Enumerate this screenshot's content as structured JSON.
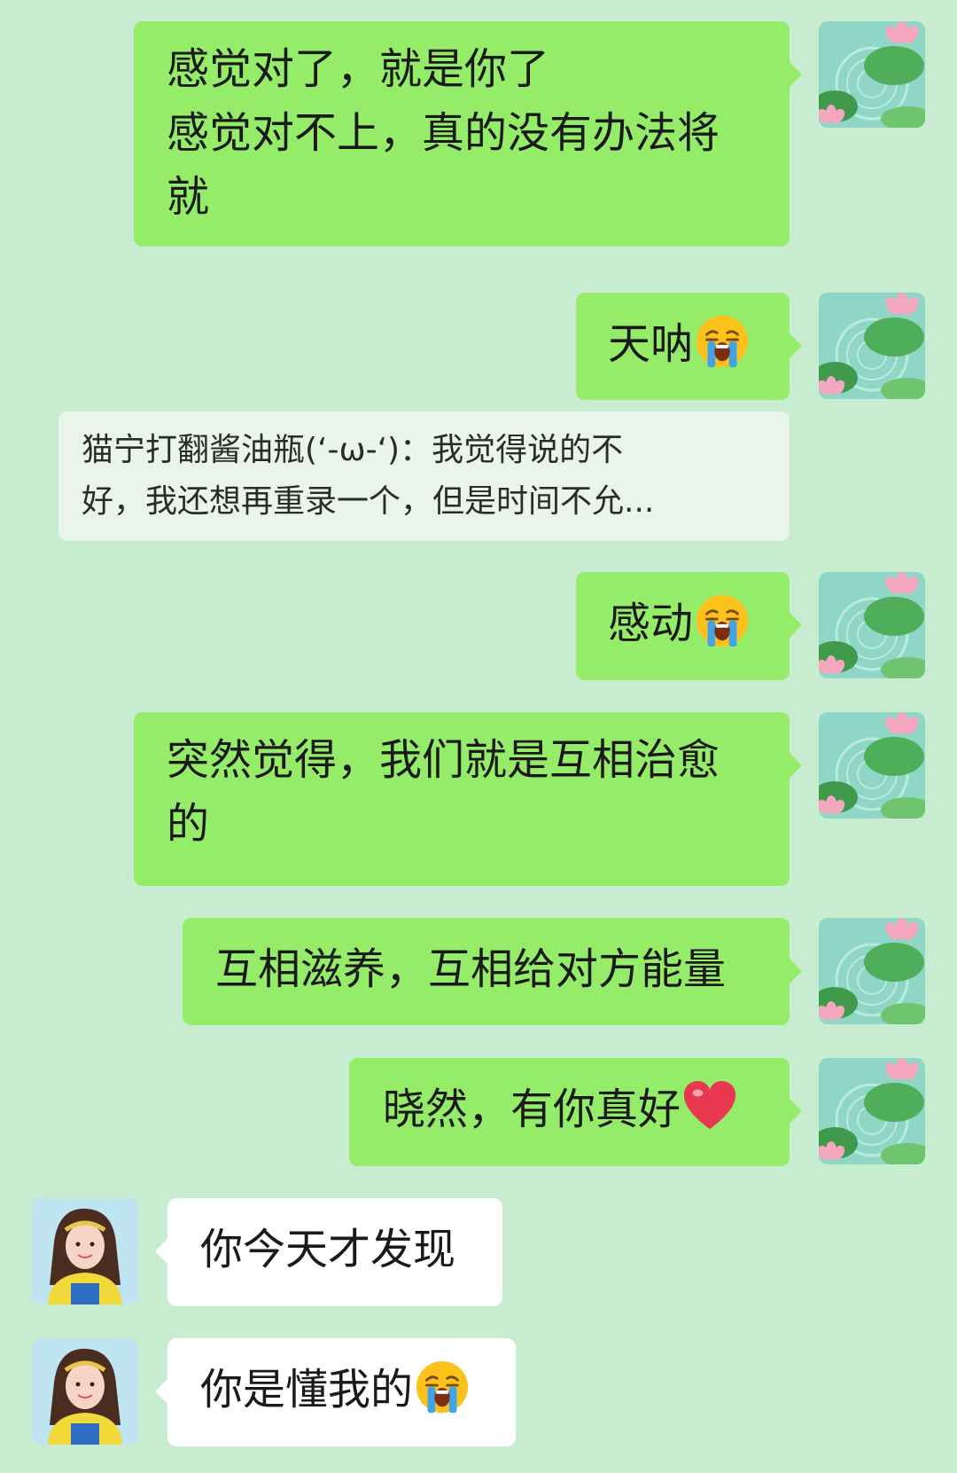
{
  "colors": {
    "background": "#c8eccf",
    "outgoing_bubble": "#95ec69",
    "incoming_bubble": "#ffffff",
    "quote_background": "#e9f5ea"
  },
  "messages": [
    {
      "side": "outgoing",
      "lines": [
        "感觉对了，就是你了",
        "感觉对不上，真的没有办法将",
        "就"
      ],
      "emoji": null
    },
    {
      "side": "outgoing",
      "lines": [
        "天呐"
      ],
      "emoji": "loudly-crying-face-icon"
    },
    {
      "side": "quote",
      "lines": [
        "猫宁打翻酱油瓶(ʻ-ω-ʻ)：我觉得说的不",
        "好，我还想再重录一个，但是时间不允..."
      ]
    },
    {
      "side": "outgoing",
      "lines": [
        "感动"
      ],
      "emoji": "loudly-crying-face-icon"
    },
    {
      "side": "outgoing",
      "lines": [
        "突然觉得，我们就是互相治愈",
        "的"
      ],
      "emoji": null
    },
    {
      "side": "outgoing",
      "lines": [
        "互相滋养，互相给对方能量"
      ],
      "emoji": null
    },
    {
      "side": "outgoing",
      "lines": [
        "晓然，有你真好"
      ],
      "emoji": "red-heart-icon"
    },
    {
      "side": "incoming",
      "lines": [
        "你今天才发现"
      ],
      "emoji": null
    },
    {
      "side": "incoming",
      "lines": [
        "你是懂我的"
      ],
      "emoji": "loudly-crying-face-icon"
    }
  ]
}
